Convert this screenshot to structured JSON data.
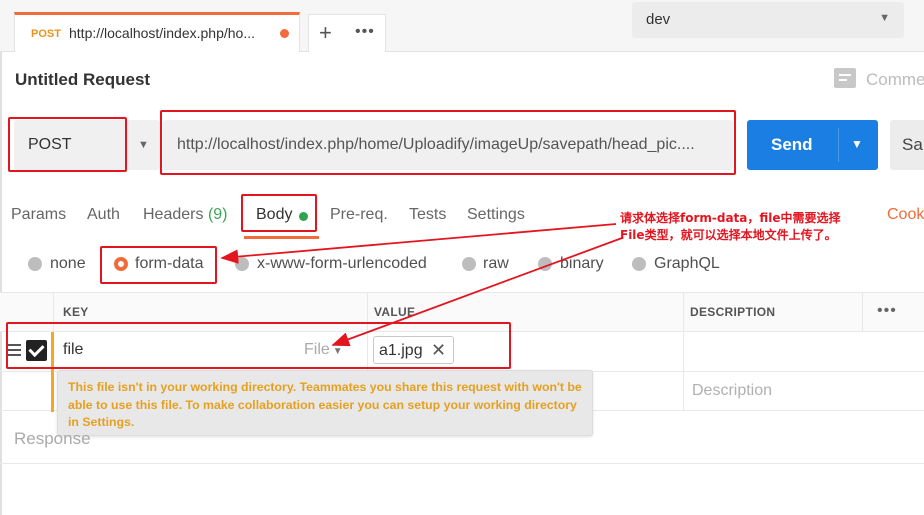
{
  "tab": {
    "method": "POST",
    "url": "http://localhost/index.php/ho...",
    "new_tab": "+",
    "more": "•••"
  },
  "environment": {
    "selected": "dev"
  },
  "request": {
    "title": "Untitled Request",
    "comments_label": "Comme",
    "method": "POST",
    "url": "http://localhost/index.php/home/Uploadify/imageUp/savepath/head_pic....",
    "send_label": "Send",
    "save_label": "Sa"
  },
  "subtabs": {
    "params": "Params",
    "auth": "Auth",
    "headers": "Headers",
    "headers_count": "(9)",
    "body": "Body",
    "prereq": "Pre-req.",
    "tests": "Tests",
    "settings": "Settings",
    "cookies": "Cook"
  },
  "body_types": {
    "none": "none",
    "form_data": "form-data",
    "urlencoded": "x-www-form-urlencoded",
    "raw": "raw",
    "binary": "binary",
    "graphql": "GraphQL",
    "selected": "form-data"
  },
  "table": {
    "headers": {
      "key": "KEY",
      "value": "VALUE",
      "description": "DESCRIPTION"
    },
    "more": "•••",
    "row": {
      "key": "file",
      "type": "File",
      "file_chip": "a1.jpg",
      "remove": "✕",
      "checked": true
    },
    "description_placeholder": "Description"
  },
  "tooltip": "This file isn't in your working directory. Teammates you share this request with won't be able to use this file. To make collaboration easier you can setup your working directory in Settings.",
  "response_label": "Response",
  "annotation": {
    "line1": "请求体选择form-data，file中需要选择",
    "line2": "File类型，就可以选择本地文件上传了。"
  },
  "colors": {
    "accent": "#f26b3a",
    "send": "#1a7ee3",
    "annotation_red": "#e3151f",
    "tooltip_text": "#e6a020",
    "count_green": "#3aa655"
  }
}
